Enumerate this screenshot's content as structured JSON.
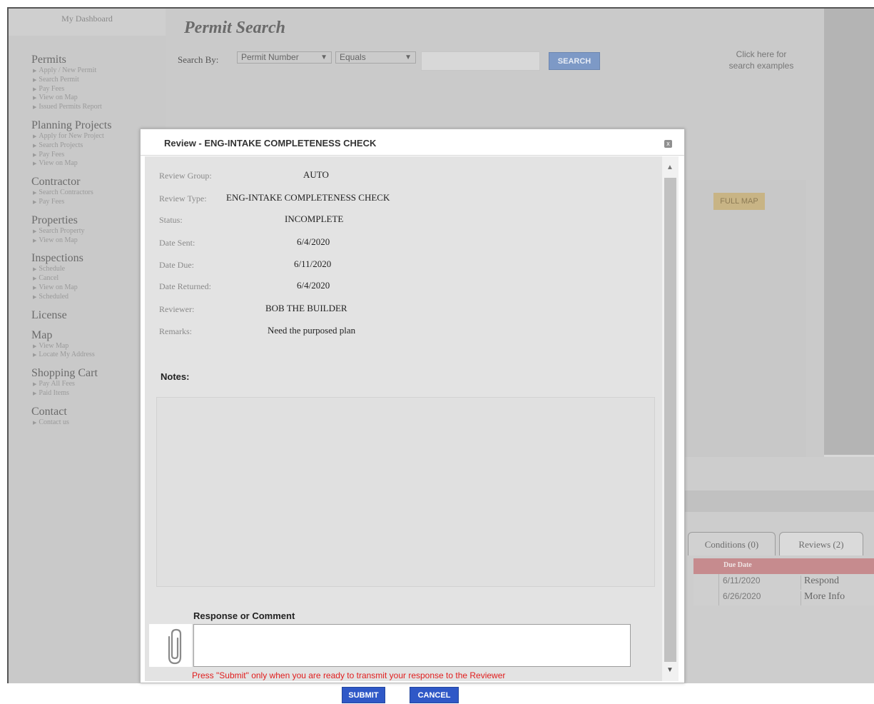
{
  "sidebar": {
    "dashboard": "My Dashboard",
    "sections": [
      {
        "title": "Permits",
        "items": [
          "Apply / New Permit",
          "Search Permit",
          "Pay Fees",
          "View on Map",
          "Issued Permits Report"
        ]
      },
      {
        "title": "Planning Projects",
        "items": [
          "Apply for New Project",
          "Search Projects",
          "Pay Fees",
          "View on Map"
        ]
      },
      {
        "title": "Contractor",
        "items": [
          "Search Contractors",
          "Pay Fees"
        ]
      },
      {
        "title": "Properties",
        "items": [
          "Search Property",
          "View on Map"
        ]
      },
      {
        "title": "Inspections",
        "items": [
          "Schedule",
          "Cancel",
          "View on Map",
          "Scheduled"
        ]
      },
      {
        "title": "License",
        "items": []
      },
      {
        "title": "Map",
        "items": [
          "View Map",
          "Locate My Address"
        ]
      },
      {
        "title": "Shopping Cart",
        "items": [
          "Pay All Fees",
          "Paid Items"
        ]
      },
      {
        "title": "Contact",
        "items": [
          "Contact us"
        ]
      }
    ]
  },
  "search": {
    "title": "Permit Search",
    "label": "Search By:",
    "field": "Permit Number",
    "operator": "Equals",
    "value": "",
    "button": "SEARCH",
    "examples_line1": "Click here for",
    "examples_line2": "search examples"
  },
  "map": {
    "full_map": "FULL MAP"
  },
  "tabs": [
    {
      "label": "Conditions (0)"
    },
    {
      "label": "Reviews (2)"
    }
  ],
  "review_table": {
    "header_due": "Due Date",
    "rows": [
      {
        "due": "6/11/2020",
        "action": "Respond"
      },
      {
        "due": "6/26/2020",
        "action": "More Info"
      }
    ]
  },
  "modal": {
    "title": "Review - ENG-INTAKE COMPLETENESS CHECK",
    "close": "x",
    "fields": [
      {
        "label": "Review Group:",
        "value": "AUTO"
      },
      {
        "label": "Review Type:",
        "value": "ENG-INTAKE COMPLETENESS CHECK"
      },
      {
        "label": "Status:",
        "value": "INCOMPLETE"
      },
      {
        "label": "Date Sent:",
        "value": "6/4/2020"
      },
      {
        "label": "Date Due:",
        "value": "6/11/2020"
      },
      {
        "label": "Date Returned:",
        "value": "6/4/2020"
      },
      {
        "label": "Reviewer:",
        "value": "BOB THE BUILDER"
      },
      {
        "label": "Remarks:",
        "value": "Need the purposed plan"
      }
    ],
    "notes_label": "Notes:",
    "response_label": "Response or Comment",
    "response_value": "",
    "warning": "Press \"Submit\" only when you are ready to transmit your response to the Reviewer",
    "submit": "SUBMIT",
    "cancel": "CANCEL"
  },
  "colors": {
    "primary_button": "#2f58c7",
    "warning_text": "#e11d1d",
    "table_header": "#c68b8e"
  },
  "icons": [
    "paperclip-icon",
    "close-icon",
    "scroll-up-icon",
    "scroll-down-icon",
    "dropdown-arrow-icon"
  ]
}
